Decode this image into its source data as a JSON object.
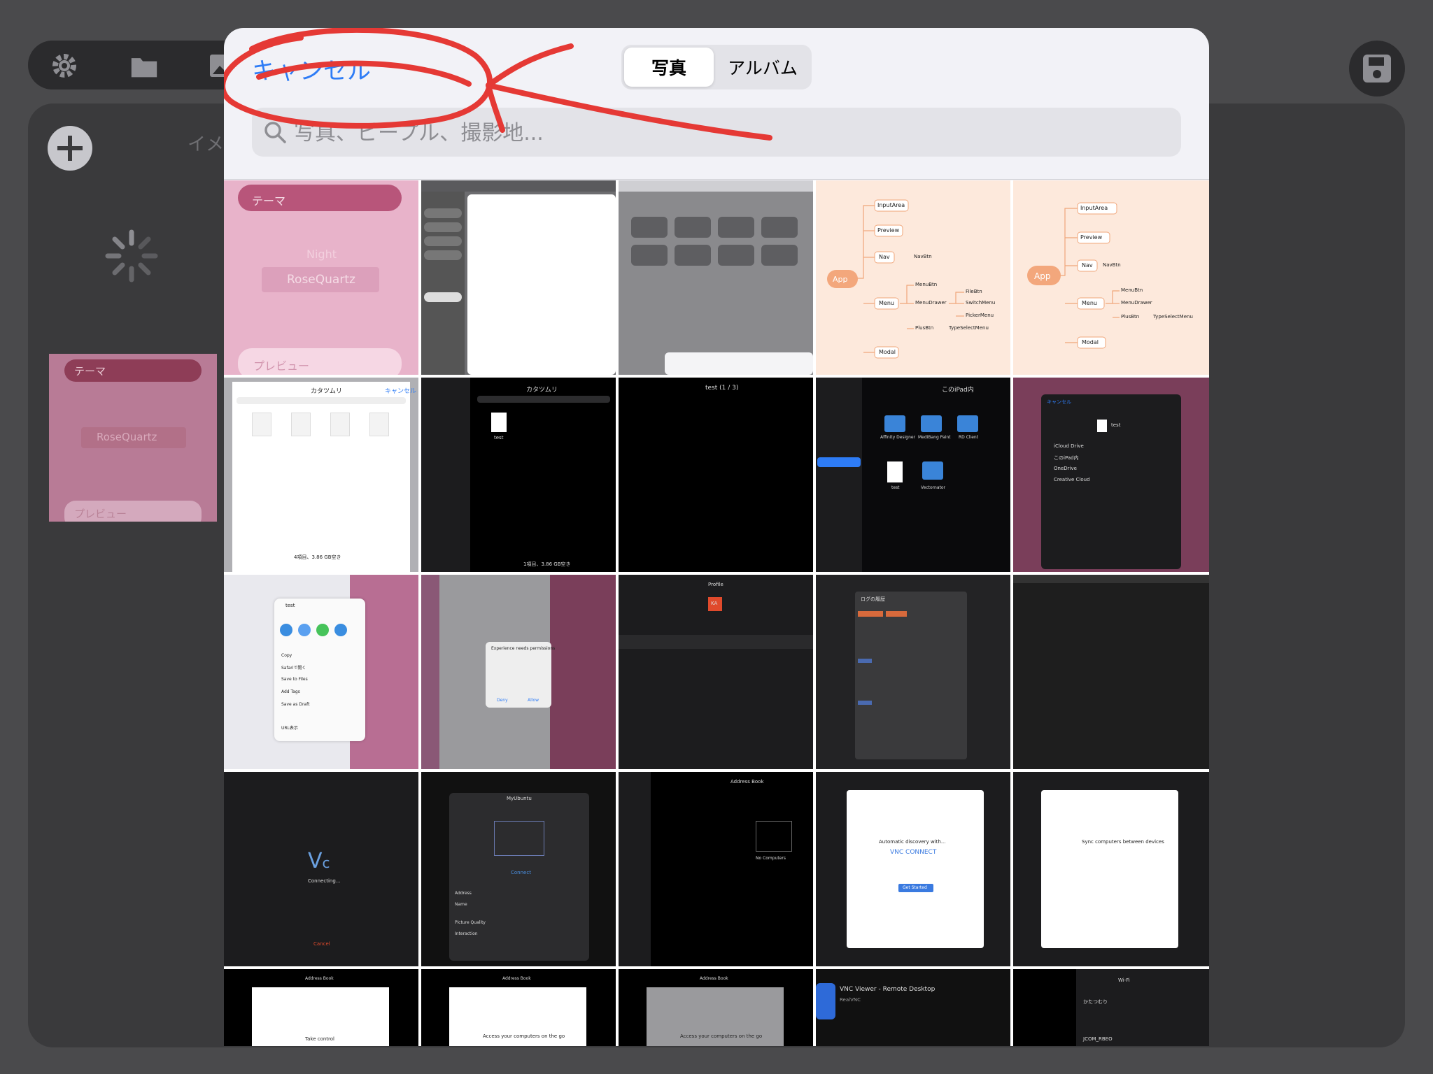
{
  "background_app": {
    "image_tool_label": "イメ",
    "preview_thumb": {
      "theme_label": "テーマ",
      "sample_text": "RoseQuartz",
      "preview_label": "プレビュー"
    }
  },
  "picker": {
    "cancel_label": "キャンセル",
    "segments": [
      {
        "label": "写真",
        "selected": true
      },
      {
        "label": "アルバム",
        "selected": false
      }
    ],
    "search_placeholder": "写真、ピープル、撮影地...",
    "accent_color": "#2e7cf6"
  },
  "grid": {
    "rows": [
      [
        {
          "kind": "pink-theme",
          "texts": [
            "テーマ",
            "Night",
            "RoseQuartz",
            "プレビュー"
          ]
        },
        {
          "kind": "dark-sidebar-white",
          "texts": []
        },
        {
          "kind": "gray-folders",
          "texts": []
        },
        {
          "kind": "mindmap",
          "texts": [
            "App",
            "InputArea",
            "Preview",
            "Nav",
            "NavBtn",
            "Menu",
            "MenuBtn",
            "MenuDrawer",
            "FileBtn",
            "SwitchMenu",
            "PickerMenu",
            "PlusBtn",
            "TypeSelectMenu",
            "Modal"
          ]
        },
        {
          "kind": "mindmap",
          "texts": [
            "App",
            "InputArea",
            "Preview",
            "Nav",
            "NavBtn",
            "Menu",
            "MenuBtn",
            "MenuDrawer",
            "PlusBtn",
            "TypeSelectMenu",
            "Modal"
          ]
        }
      ],
      [
        {
          "kind": "files-white",
          "texts": [
            "カタツムリ",
            "キャンセル",
            "4項目、3.86 GB空き"
          ]
        },
        {
          "kind": "files-dark-one",
          "texts": [
            "カタツムリ",
            "test",
            "1項目、3.86 GB空き"
          ]
        },
        {
          "kind": "dark-title",
          "texts": [
            "test (1 / 3)"
          ]
        },
        {
          "kind": "files-dark-grid",
          "texts": [
            "このiPad内",
            "Affinity Designer",
            "MediBang Paint",
            "RD Client",
            "test",
            "Vectornator"
          ]
        },
        {
          "kind": "save-dialog",
          "texts": [
            "キャンセル",
            "test",
            "iCloud Drive",
            "このiPad内",
            "OneDrive",
            "Creative Cloud"
          ]
        }
      ],
      [
        {
          "kind": "share-sheet",
          "texts": [
            "test",
            "Copy",
            "Safariで開く",
            "Save to Files",
            "Add Tags",
            "Save as Draft",
            "URL表示"
          ]
        },
        {
          "kind": "permission-alert",
          "texts": [
            "Experience needs permissions",
            "Deny",
            "Allow"
          ]
        },
        {
          "kind": "profile-dark",
          "texts": [
            "Profile",
            "KA"
          ]
        },
        {
          "kind": "git-log",
          "texts": [
            "ログの履歴"
          ]
        },
        {
          "kind": "code-dark",
          "texts": []
        },
        {
          "kind": "markdown-dark",
          "texts": []
        }
      ],
      [
        {
          "kind": "vnc-connecting",
          "texts": [
            "Connecting...",
            "Cancel"
          ]
        },
        {
          "kind": "vnc-myubuntu",
          "texts": [
            "MyUbuntu",
            "Connect",
            "Address",
            "Name",
            "Picture Quality",
            "Interaction"
          ]
        },
        {
          "kind": "vnc-addressbook",
          "texts": [
            "Address Book",
            "No Computers"
          ]
        },
        {
          "kind": "vnc-connect-dialog",
          "texts": [
            "Automatic discovery with...",
            "VNC CONNECT",
            "Get Started"
          ]
        },
        {
          "kind": "vnc-sync-dialog",
          "texts": [
            "Sync computers between devices"
          ]
        }
      ],
      [
        {
          "kind": "vnc-take-control",
          "texts": [
            "Address Book",
            "Take control"
          ]
        },
        {
          "kind": "vnc-access",
          "texts": [
            "Address Book",
            "Access your computers on the go"
          ]
        },
        {
          "kind": "vnc-access-gray",
          "texts": [
            "Address Book",
            "Access your computers on the go"
          ]
        },
        {
          "kind": "appstore-vnc",
          "texts": [
            "VNC Viewer - Remote Desktop",
            "RealVNC"
          ]
        },
        {
          "kind": "wifi-settings",
          "texts": [
            "Wi-Fi",
            "かたつむり",
            "JCOM_RBEO"
          ]
        }
      ]
    ]
  }
}
